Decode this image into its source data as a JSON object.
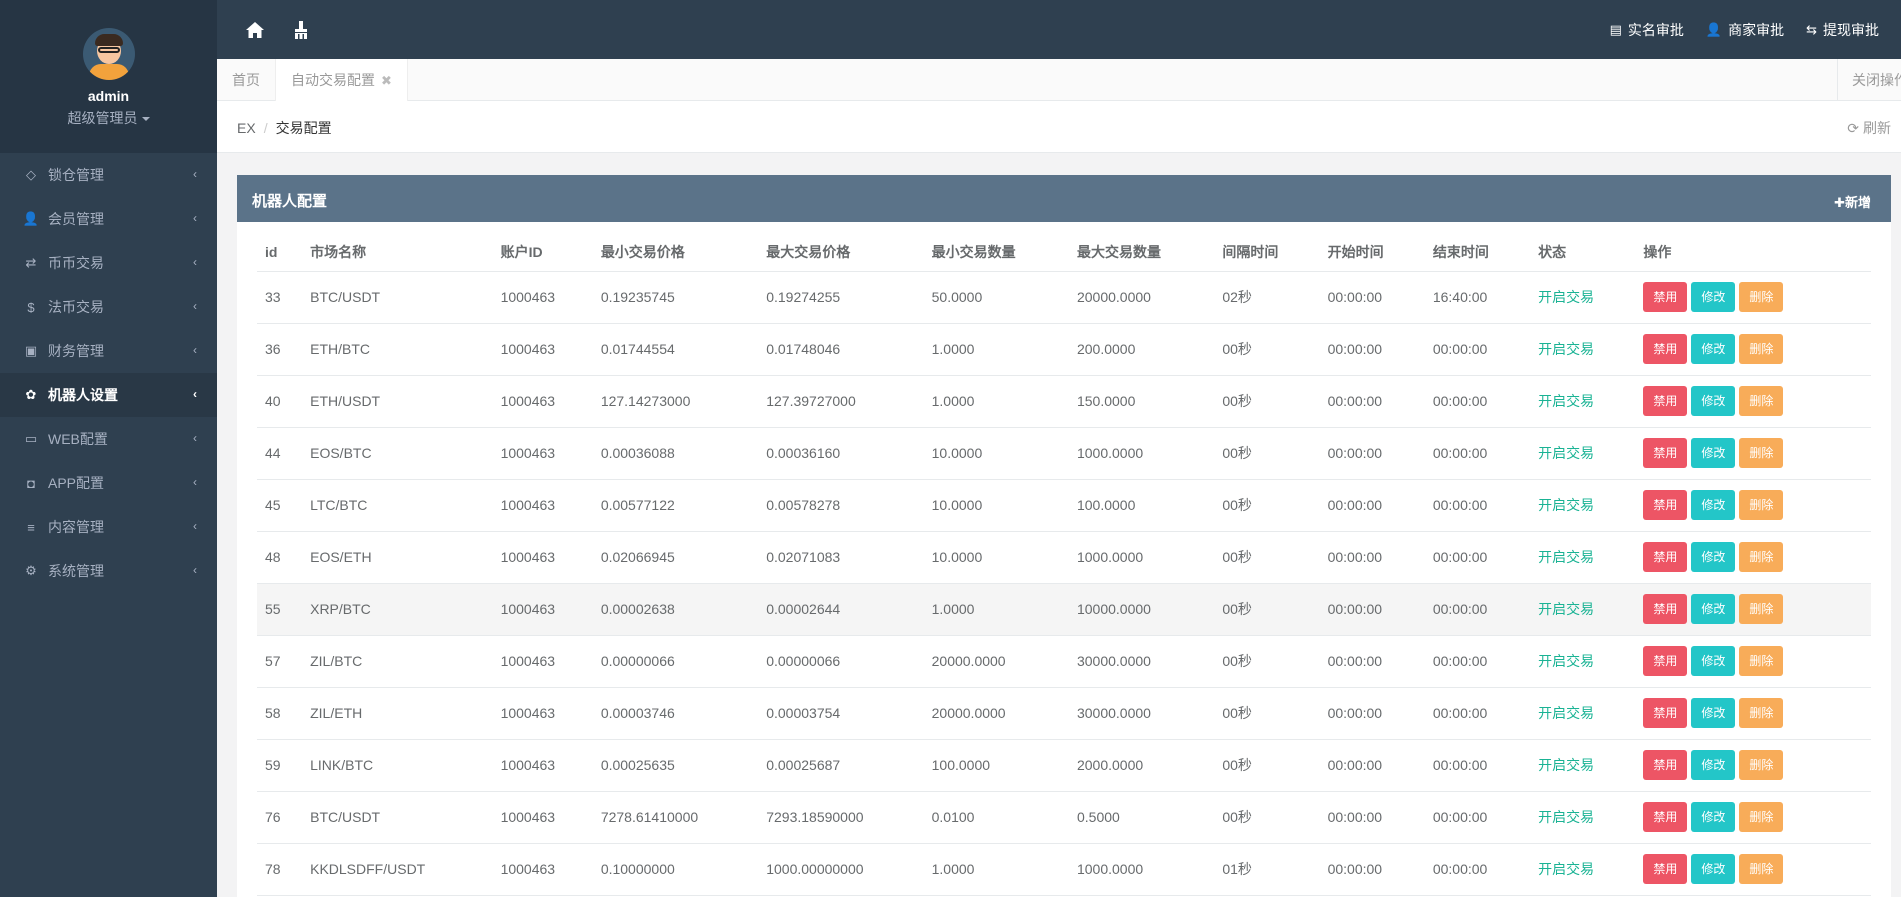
{
  "sidebar": {
    "profile": {
      "name": "admin",
      "role": "超级管理员"
    },
    "items": [
      {
        "label": "锁仓管理",
        "icon": "diamond-icon",
        "glyph": "◇",
        "active": false
      },
      {
        "label": "会员管理",
        "icon": "user-icon",
        "glyph": "👤",
        "active": false
      },
      {
        "label": "币币交易",
        "icon": "exchange-icon",
        "glyph": "⇄",
        "active": false
      },
      {
        "label": "法币交易",
        "icon": "dollar-icon",
        "glyph": "$",
        "active": false
      },
      {
        "label": "财务管理",
        "icon": "money-icon",
        "glyph": "▣",
        "active": false
      },
      {
        "label": "机器人设置",
        "icon": "paw-icon",
        "glyph": "✿",
        "active": true
      },
      {
        "label": "WEB配置",
        "icon": "laptop-icon",
        "glyph": "▭",
        "active": false
      },
      {
        "label": "APP配置",
        "icon": "android-icon",
        "glyph": "◘",
        "active": false
      },
      {
        "label": "内容管理",
        "icon": "list-icon",
        "glyph": "≡",
        "active": false
      },
      {
        "label": "系统管理",
        "icon": "gears-icon",
        "glyph": "⚙",
        "active": false
      }
    ]
  },
  "topbar": {
    "links": [
      {
        "label": "实名审批",
        "icon": "id-card-icon",
        "glyph": "▤"
      },
      {
        "label": "商家审批",
        "icon": "user-icon",
        "glyph": "👤"
      },
      {
        "label": "提现审批",
        "icon": "retweet-icon",
        "glyph": "⇆"
      }
    ]
  },
  "tabs": {
    "home": "首页",
    "current": "自动交易配置",
    "close_label": "关闭操作"
  },
  "breadcrumb": {
    "root": "EX",
    "current": "交易配置",
    "refresh": "刷新"
  },
  "panel": {
    "title": "机器人配置",
    "add_label": "新增",
    "columns": [
      "id",
      "市场名称",
      "账户ID",
      "最小交易价格",
      "最大交易价格",
      "最小交易数量",
      "最大交易数量",
      "间隔时间",
      "开始时间",
      "结束时间",
      "状态",
      "操作"
    ],
    "actions": {
      "disable": "禁用",
      "edit": "修改",
      "delete": "删除"
    },
    "rows": [
      [
        "33",
        "BTC/USDT",
        "1000463",
        "0.19235745",
        "0.19274255",
        "50.0000",
        "20000.0000",
        "02秒",
        "00:00:00",
        "16:40:00",
        "开启交易"
      ],
      [
        "36",
        "ETH/BTC",
        "1000463",
        "0.01744554",
        "0.01748046",
        "1.0000",
        "200.0000",
        "00秒",
        "00:00:00",
        "00:00:00",
        "开启交易"
      ],
      [
        "40",
        "ETH/USDT",
        "1000463",
        "127.14273000",
        "127.39727000",
        "1.0000",
        "150.0000",
        "00秒",
        "00:00:00",
        "00:00:00",
        "开启交易"
      ],
      [
        "44",
        "EOS/BTC",
        "1000463",
        "0.00036088",
        "0.00036160",
        "10.0000",
        "1000.0000",
        "00秒",
        "00:00:00",
        "00:00:00",
        "开启交易"
      ],
      [
        "45",
        "LTC/BTC",
        "1000463",
        "0.00577122",
        "0.00578278",
        "10.0000",
        "100.0000",
        "00秒",
        "00:00:00",
        "00:00:00",
        "开启交易"
      ],
      [
        "48",
        "EOS/ETH",
        "1000463",
        "0.02066945",
        "0.02071083",
        "10.0000",
        "1000.0000",
        "00秒",
        "00:00:00",
        "00:00:00",
        "开启交易"
      ],
      [
        "55",
        "XRP/BTC",
        "1000463",
        "0.00002638",
        "0.00002644",
        "1.0000",
        "10000.0000",
        "00秒",
        "00:00:00",
        "00:00:00",
        "开启交易"
      ],
      [
        "57",
        "ZIL/BTC",
        "1000463",
        "0.00000066",
        "0.00000066",
        "20000.0000",
        "30000.0000",
        "00秒",
        "00:00:00",
        "00:00:00",
        "开启交易"
      ],
      [
        "58",
        "ZIL/ETH",
        "1000463",
        "0.00003746",
        "0.00003754",
        "20000.0000",
        "30000.0000",
        "00秒",
        "00:00:00",
        "00:00:00",
        "开启交易"
      ],
      [
        "59",
        "LINK/BTC",
        "1000463",
        "0.00025635",
        "0.00025687",
        "100.0000",
        "2000.0000",
        "00秒",
        "00:00:00",
        "00:00:00",
        "开启交易"
      ],
      [
        "76",
        "BTC/USDT",
        "1000463",
        "7278.61410000",
        "7293.18590000",
        "0.0100",
        "0.5000",
        "00秒",
        "00:00:00",
        "00:00:00",
        "开启交易"
      ],
      [
        "78",
        "KKDLSDFF/USDT",
        "1000463",
        "0.10000000",
        "1000.00000000",
        "1.0000",
        "1000.0000",
        "01秒",
        "00:00:00",
        "00:00:00",
        "开启交易"
      ]
    ]
  },
  "colors": {
    "sidebar_bg": "#2f4050",
    "panel_header": "#5b7389",
    "status_green": "#1ab394",
    "btn_red": "#ed5565",
    "btn_cyan": "#23c6c8",
    "btn_orange": "#f8ac59"
  }
}
